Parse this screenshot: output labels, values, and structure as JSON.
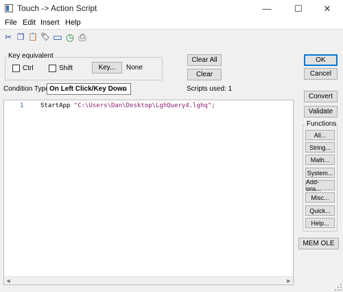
{
  "window": {
    "title": "Touch -> Action Script",
    "minimize_glyph": "—",
    "maximize_glyph": "☐",
    "close_glyph": "✕"
  },
  "menu": {
    "file": "File",
    "edit": "Edit",
    "insert": "Insert",
    "help": "Help"
  },
  "toolbar": {
    "icons": [
      "cut-icon",
      "copy-icon",
      "paste-icon",
      "tag-icon",
      "window-icon",
      "clock-icon",
      "print-icon"
    ],
    "glyphs": {
      "cut": "✂",
      "copy": "❐",
      "paste": "📋",
      "tag": "🏷",
      "window": "▭",
      "clock": "◷",
      "print": "⎙"
    }
  },
  "key_equivalent": {
    "legend": "Key equivalent",
    "ctrl_label": "Ctrl",
    "ctrl_checked": false,
    "shift_label": "Shift",
    "shift_checked": false,
    "key_button": "Key...",
    "current_key": "None"
  },
  "actions": {
    "clear_all": "Clear All",
    "clear": "Clear"
  },
  "condition": {
    "label": "Condition Type:",
    "value": "On Left Click/Key Down",
    "arrow": "⌄"
  },
  "scripts_used": "Scripts used: 1",
  "editor": {
    "line_number": "1",
    "command": "StartApp ",
    "argument": "\"C:\\Users\\Dan\\Desktop\\LghQuery4.lghq\";",
    "scroll_left": "◀",
    "scroll_right": "▶"
  },
  "right_panel": {
    "ok": "OK",
    "cancel": "Cancel",
    "convert": "Convert",
    "validate": "Validate",
    "functions_legend": "Functions",
    "functions": [
      "All...",
      "String...",
      "Math...",
      "System...",
      "Add-ons...",
      "Misc...",
      "Quick...",
      "Help..."
    ],
    "mem_ole": "MEM OLE"
  },
  "colors": {
    "background": "#f0f0f0",
    "default_button_border": "#0078d7",
    "line_number": "#3b5bbf",
    "string_literal": "#8b1e6e"
  }
}
